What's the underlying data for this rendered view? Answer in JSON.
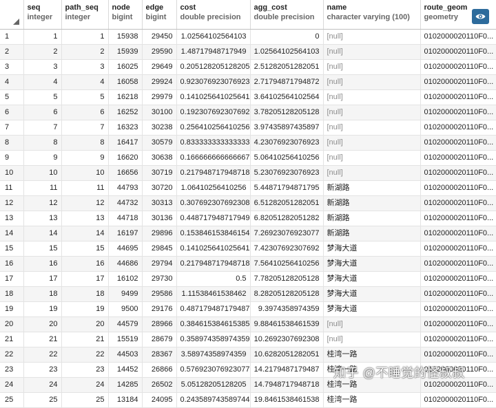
{
  "columns": [
    {
      "name": "",
      "type": ""
    },
    {
      "name": "seq",
      "type": "integer"
    },
    {
      "name": "path_seq",
      "type": "integer"
    },
    {
      "name": "node",
      "type": "bigint"
    },
    {
      "name": "edge",
      "type": "bigint"
    },
    {
      "name": "cost",
      "type": "double precision"
    },
    {
      "name": "agg_cost",
      "type": "double precision"
    },
    {
      "name": "name",
      "type": "character varying (100)"
    },
    {
      "name": "route_geom",
      "type": "geometry"
    }
  ],
  "rows": [
    [
      "1",
      "1",
      "1",
      "15938",
      "29450",
      "1.02564102564103",
      "0",
      "[null]",
      "0102000020110F0..."
    ],
    [
      "2",
      "2",
      "2",
      "15939",
      "29590",
      "1.48717948717949",
      "1.02564102564103",
      "[null]",
      "0102000020110F0..."
    ],
    [
      "3",
      "3",
      "3",
      "16025",
      "29649",
      "0.205128205128205",
      "2.51282051282051",
      "[null]",
      "0102000020110F0..."
    ],
    [
      "4",
      "4",
      "4",
      "16058",
      "29924",
      "0.923076923076923",
      "2.71794871794872",
      "[null]",
      "0102000020110F0..."
    ],
    [
      "5",
      "5",
      "5",
      "16218",
      "29979",
      "0.141025641025641",
      "3.64102564102564",
      "[null]",
      "0102000020110F0..."
    ],
    [
      "6",
      "6",
      "6",
      "16252",
      "30100",
      "0.192307692307692",
      "3.78205128205128",
      "[null]",
      "0102000020110F0..."
    ],
    [
      "7",
      "7",
      "7",
      "16323",
      "30238",
      "0.256410256410256",
      "3.97435897435897",
      "[null]",
      "0102000020110F0..."
    ],
    [
      "8",
      "8",
      "8",
      "16417",
      "30579",
      "0.833333333333333",
      "4.23076923076923",
      "[null]",
      "0102000020110F0..."
    ],
    [
      "9",
      "9",
      "9",
      "16620",
      "30638",
      "0.166666666666667",
      "5.06410256410256",
      "[null]",
      "0102000020110F0..."
    ],
    [
      "10",
      "10",
      "10",
      "16656",
      "30719",
      "0.217948717948718",
      "5.23076923076923",
      "[null]",
      "0102000020110F0..."
    ],
    [
      "11",
      "11",
      "11",
      "44793",
      "30720",
      "1.06410256410256",
      "5.44871794871795",
      "新湖路",
      "0102000020110F0..."
    ],
    [
      "12",
      "12",
      "12",
      "44732",
      "30313",
      "0.307692307692308",
      "6.51282051282051",
      "新湖路",
      "0102000020110F0..."
    ],
    [
      "13",
      "13",
      "13",
      "44718",
      "30136",
      "0.448717948717949",
      "6.82051282051282",
      "新湖路",
      "0102000020110F0..."
    ],
    [
      "14",
      "14",
      "14",
      "16197",
      "29896",
      "0.153846153846154",
      "7.26923076923077",
      "新湖路",
      "0102000020110F0..."
    ],
    [
      "15",
      "15",
      "15",
      "44695",
      "29845",
      "0.141025641025641",
      "7.42307692307692",
      "梦海大道",
      "0102000020110F0..."
    ],
    [
      "16",
      "16",
      "16",
      "44686",
      "29794",
      "0.217948717948718",
      "7.56410256410256",
      "梦海大道",
      "0102000020110F0..."
    ],
    [
      "17",
      "17",
      "17",
      "16102",
      "29730",
      "0.5",
      "7.78205128205128",
      "梦海大道",
      "0102000020110F0..."
    ],
    [
      "18",
      "18",
      "18",
      "9499",
      "29586",
      "1.11538461538462",
      "8.28205128205128",
      "梦海大道",
      "0102000020110F0..."
    ],
    [
      "19",
      "19",
      "19",
      "9500",
      "29176",
      "0.487179487179487",
      "9.3974358974359",
      "梦海大道",
      "0102000020110F0..."
    ],
    [
      "20",
      "20",
      "20",
      "44579",
      "28966",
      "0.384615384615385",
      "9.88461538461539",
      "[null]",
      "0102000020110F0..."
    ],
    [
      "21",
      "21",
      "21",
      "15519",
      "28679",
      "0.358974358974359",
      "10.2692307692308",
      "[null]",
      "0102000020110F0..."
    ],
    [
      "22",
      "22",
      "22",
      "44503",
      "28367",
      "3.58974358974359",
      "10.6282051282051",
      "桂湾一路",
      "0102000020110F0..."
    ],
    [
      "23",
      "23",
      "23",
      "14452",
      "26866",
      "0.576923076923077",
      "14.2179487179487",
      "桂湾一路",
      "0102000020110F0..."
    ],
    [
      "24",
      "24",
      "24",
      "14285",
      "26502",
      "5.05128205128205",
      "14.7948717948718",
      "桂湾一路",
      "0102000020110F0..."
    ],
    [
      "25",
      "25",
      "25",
      "13184",
      "24095",
      "0.243589743589744",
      "19.8461538461538",
      "桂湾一路",
      "0102000020110F0..."
    ]
  ],
  "align": [
    "left",
    "num",
    "num",
    "num",
    "num",
    "num",
    "num",
    "txt",
    "txt"
  ],
  "icons": {
    "view_geometry": "eye-icon",
    "sort_corner": "corner-triangle-icon"
  },
  "colors": {
    "view_button_bg": "#2d6b9c",
    "null_text": "#8c8c8c",
    "alt_row": "#f5f5f5"
  },
  "watermark": "知乎 @不睡觉的怪叔叔"
}
